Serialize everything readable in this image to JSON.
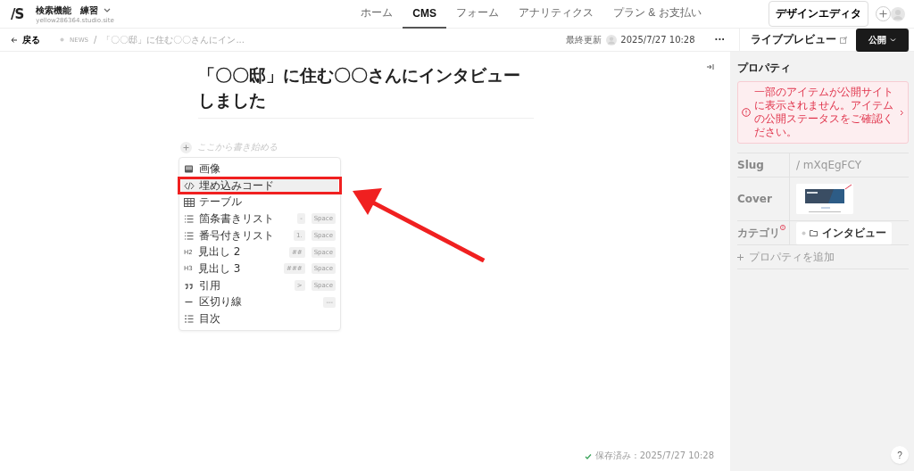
{
  "project": {
    "logo": "/S",
    "name": "検索機能　練習",
    "domain": "yellow286364.studio.site"
  },
  "nav_tabs": [
    {
      "label": "ホーム",
      "selected": false
    },
    {
      "label": "CMS",
      "selected": true
    },
    {
      "label": "フォーム",
      "selected": false
    },
    {
      "label": "アナリティクス",
      "selected": false
    },
    {
      "label": "プラン & お支払い",
      "selected": false
    }
  ],
  "design_editor_button": "デザインエディタ",
  "subbar": {
    "back": "戻る",
    "separator": "/",
    "breadcrumb": [
      "NEWS",
      "「〇〇邸」に住む〇〇さんにイン..."
    ],
    "updated_label": "最終更新",
    "updated_time": "2025/7/27 10:28",
    "more": "···",
    "live_preview": "ライブプレビュー",
    "publish": "公開"
  },
  "editor": {
    "title": "「〇〇邸」に住む〇〇さんにインタビューしました",
    "placeholder": "ここから書き始める",
    "saved": "保存済み : 2025/7/27 10:28"
  },
  "block_menu": [
    {
      "kind": "image",
      "label": "画像",
      "selected": false,
      "highlighted": false
    },
    {
      "kind": "code",
      "label": "埋め込みコード",
      "selected": true,
      "highlighted": true
    },
    {
      "kind": "table",
      "label": "テーブル",
      "selected": false,
      "highlighted": false
    },
    {
      "kind": "list",
      "label": "箇条書きリスト",
      "keys": [
        "-",
        "Space"
      ],
      "selected": false,
      "highlighted": false
    },
    {
      "kind": "numbered",
      "label": "番号付きリスト",
      "keys": [
        "1.",
        "Space"
      ],
      "selected": false,
      "highlighted": false
    },
    {
      "kind": "heading",
      "marker": "H2",
      "label": "見出し 2",
      "keys": [
        "##",
        "Space"
      ],
      "selected": false,
      "highlighted": false
    },
    {
      "kind": "heading",
      "marker": "H3",
      "label": "見出し 3",
      "keys": [
        "###",
        "Space"
      ],
      "selected": false,
      "highlighted": false
    },
    {
      "kind": "quote",
      "label": "引用",
      "keys": [
        ">",
        "Space"
      ],
      "selected": false,
      "highlighted": false
    },
    {
      "kind": "divider",
      "label": "区切り線",
      "keys": [
        "---"
      ],
      "selected": false,
      "highlighted": false
    },
    {
      "kind": "toc",
      "label": "目次",
      "selected": false,
      "highlighted": false
    }
  ],
  "properties": {
    "title": "プロパティ",
    "alert": "一部のアイテムが公開サイトに表示されません。アイテムの公開ステータスをご確認ください。",
    "rows": [
      {
        "kind": "text",
        "label": "Slug",
        "value": "/ mXqEgFCY"
      },
      {
        "kind": "cover",
        "label": "Cover"
      },
      {
        "kind": "tag",
        "label": "カテゴリ",
        "warning": true,
        "value": "インタビュー"
      }
    ],
    "add": "プロパティを追加"
  },
  "help": "?"
}
